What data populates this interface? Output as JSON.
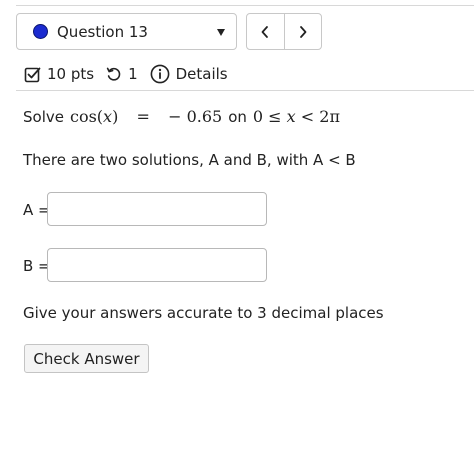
{
  "header": {
    "question_label": "Question 13",
    "status_dot_color": "#1b2bd0",
    "prev_icon": "chevron-left-icon",
    "next_icon": "chevron-right-icon"
  },
  "meta": {
    "points": "10 pts",
    "attempts": "1",
    "details_label": "Details"
  },
  "problem": {
    "prefix": "Solve",
    "equation_lhs": "cos(",
    "equation_var": "x",
    "equation_close": ")",
    "equals": "=",
    "value": "− 0.65",
    "on_word": "on",
    "range_start": "0 ≤",
    "range_var": "x",
    "range_end": "< 2π"
  },
  "info_text": "There are two solutions, A and B, with A < B",
  "answers": [
    {
      "label": "A =",
      "value": ""
    },
    {
      "label": "B =",
      "value": ""
    }
  ],
  "accuracy_text": "Give your answers accurate to 3 decimal places",
  "check_button_label": "Check Answer"
}
